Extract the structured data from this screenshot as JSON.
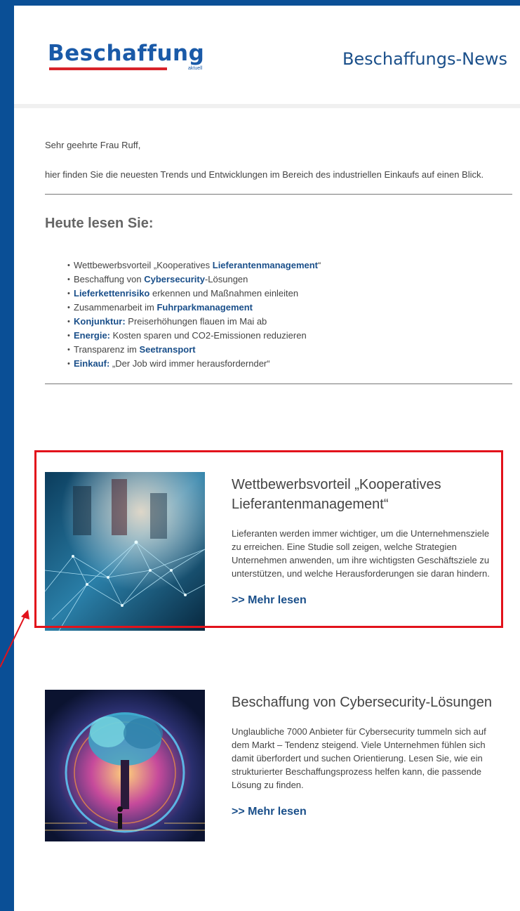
{
  "header": {
    "logo_text": "Beschaffung",
    "logo_sub": "aktuell",
    "title": "Beschaffungs-News"
  },
  "intro": {
    "greeting": "Sehr geehrte Frau Ruff,",
    "text": "hier finden Sie die neuesten Trends und Entwicklungen im Bereich des industriellen Einkaufs auf einen Blick."
  },
  "toc": {
    "heading": "Heute lesen Sie:",
    "items": [
      {
        "pre": "Wettbewerbsvorteil „Kooperatives ",
        "hl": "Lieferantenmanagement",
        "post": "“"
      },
      {
        "pre": "Beschaffung von ",
        "hl": "Cybersecurity",
        "post": "-Lösungen"
      },
      {
        "pre": "",
        "hl": "Lieferkettenrisiko",
        "post": " erkennen und Maßnahmen einleiten"
      },
      {
        "pre": "Zusammenarbeit im ",
        "hl": "Fuhrparkmanagement",
        "post": ""
      },
      {
        "pre": "",
        "hl": "Konjunktur:",
        "post": " Preiserhöhungen flauen im Mai ab"
      },
      {
        "pre": "",
        "hl": "Energie:",
        "post": " Kosten sparen und CO2-Emissionen reduzieren"
      },
      {
        "pre": "Transparenz im ",
        "hl": "Seetransport",
        "post": ""
      },
      {
        "pre": "",
        "hl": "Einkauf:",
        "post": " „Der Job wird immer herausfordernder“"
      }
    ]
  },
  "articles": [
    {
      "title": "Wettbewerbsvorteil „Kooperatives Lieferantenmanagement“",
      "body": "Lieferanten werden immer wichtiger, um die Unternehmensziele zu erreichen. Eine Studie soll zeigen, welche Strategien Unternehmen anwenden, um ihre wichtigsten Geschäftsziele zu unterstützen, und welche Herausforderungen sie daran hindern.",
      "link": ">> Mehr lesen"
    },
    {
      "title": "Beschaffung von Cybersecurity-Lösungen",
      "body": "Unglaubliche 7000 Anbieter für Cybersecurity tummeln sich auf dem Markt – Tendenz steigend. Viele Unternehmen fühlen sich damit überfordert und suchen Orientierung. Lesen Sie, wie ein strukturierter Beschaffungsprozess helfen kann, die passende Lösung zu finden.",
      "link": ">> Mehr lesen"
    }
  ],
  "colors": {
    "brand_blue": "#1a4f8a",
    "frame_blue": "#0a4f96",
    "highlight_red": "#e2121b"
  }
}
